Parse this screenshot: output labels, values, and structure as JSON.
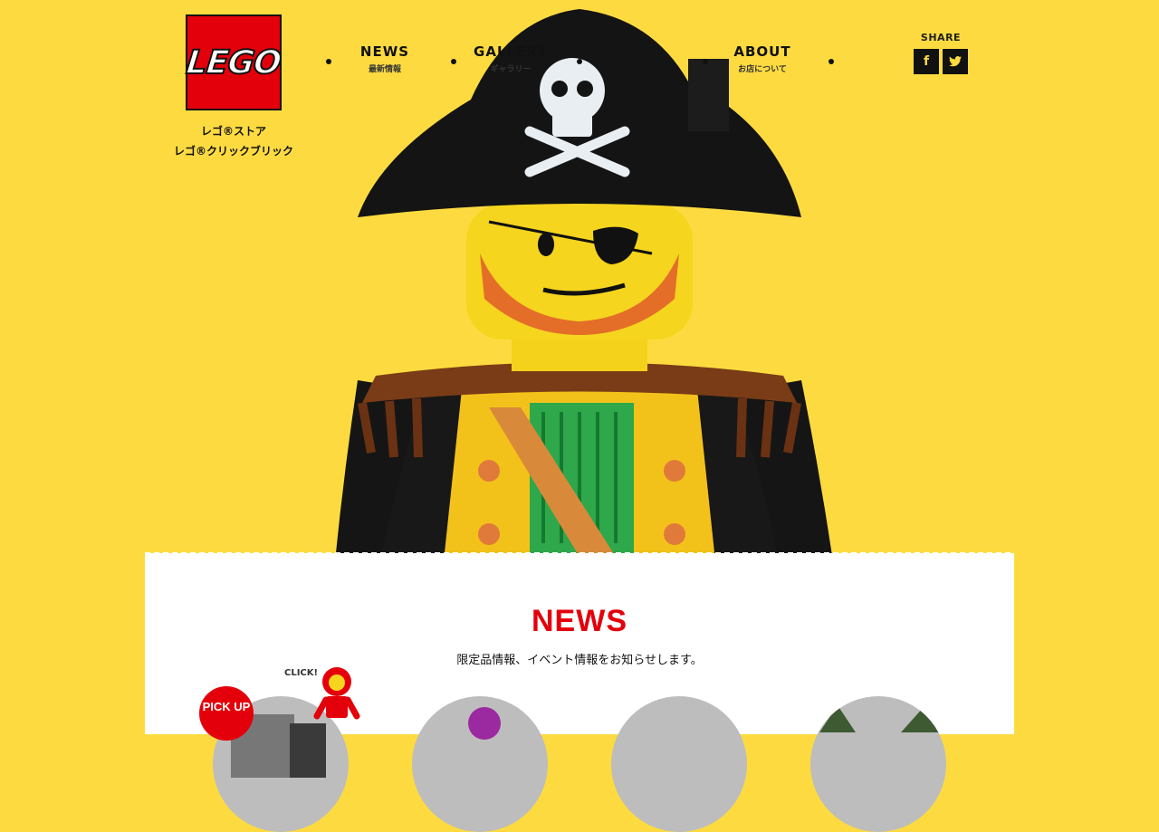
{
  "brand": {
    "logo_text": "LEGO"
  },
  "store_links": [
    "レゴ®ストア",
    "レゴ®クリックブリック"
  ],
  "nav": [
    {
      "en": "NEWS",
      "ja": "最新情報"
    },
    {
      "en": "GALLERY",
      "ja": "ギャラリー"
    },
    {
      "en": "",
      "ja": ""
    },
    {
      "en": "ABOUT",
      "ja": "お店について"
    }
  ],
  "share": {
    "label": "SHARE",
    "facebook": "f",
    "twitter": "t"
  },
  "news": {
    "title": "NEWS",
    "subtitle": "限定品情報、イベント情報をお知らせします。",
    "pickup": "PICK UP",
    "click": "CLICK!"
  },
  "colors": {
    "background": "#FDDB40",
    "accent": "#E3000B",
    "panel": "#FFFFFF"
  }
}
